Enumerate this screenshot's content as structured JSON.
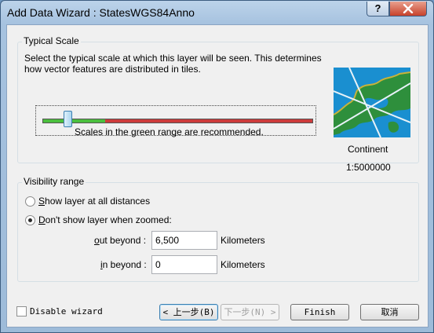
{
  "window": {
    "title": "Add Data Wizard : StatesWGS84Anno",
    "help_label": "?",
    "close_label": "x"
  },
  "typical_scale": {
    "group_label": "Typical Scale",
    "description_line1": "Select the typical scale at which this layer will be seen. This determines",
    "description_line2": "how vector features are distributed in tiles.",
    "slider_value_fraction": 0.08,
    "recommended_range_fraction": 0.23,
    "recommended_note": "Scales in the green range are recommended.",
    "preview_name": "Continent",
    "preview_scale": "1:5000000"
  },
  "visibility": {
    "group_label": "Visibility range",
    "option_show_all": {
      "key": "S",
      "rest": "how layer at all distances",
      "selected": false
    },
    "option_dont_show": {
      "key": "D",
      "rest": "on't show layer when zoomed:",
      "selected": true
    },
    "out_beyond": {
      "key": "o",
      "rest": "ut beyond :",
      "value": "6,500",
      "unit": "Kilometers"
    },
    "in_beyond": {
      "key": "i",
      "rest": "n beyond :",
      "value": "0",
      "unit": "Kilometers"
    }
  },
  "footer": {
    "disable_wizard_label": "Disable wizard",
    "disable_wizard_checked": false,
    "back_label": "< 上一步(B)",
    "next_label": "下一步(N) >",
    "finish_label": "Finish",
    "cancel_label": "取消"
  }
}
